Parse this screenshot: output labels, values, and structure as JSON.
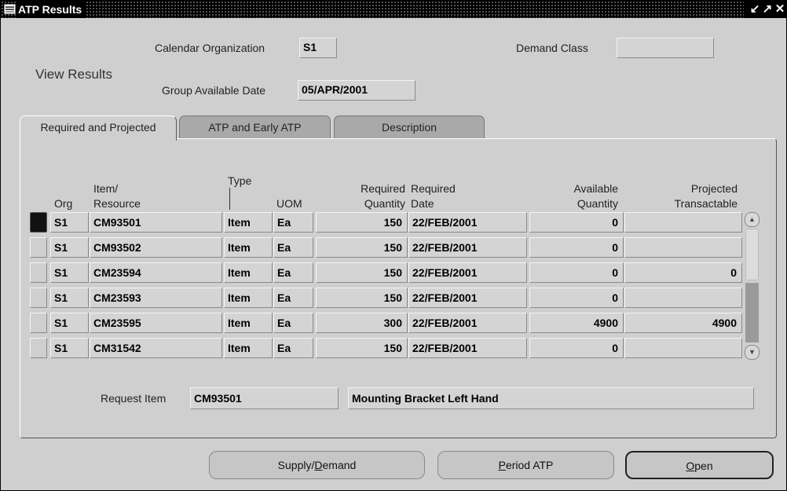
{
  "window": {
    "title": "ATP Results",
    "controls": [
      "↙",
      "↗",
      "✕"
    ]
  },
  "header": {
    "view_results_label": "View Results",
    "calendar_org_label": "Calendar Organization",
    "calendar_org_value": "S1",
    "demand_class_label": "Demand Class",
    "demand_class_value": "",
    "group_date_label": "Group Available Date",
    "group_date_value": "05/APR/2001"
  },
  "tabs": [
    {
      "label": "Required and Projected",
      "active": true
    },
    {
      "label": "ATP and Early ATP",
      "active": false
    },
    {
      "label": "Description",
      "active": false
    }
  ],
  "table": {
    "headers": {
      "org": "Org",
      "item1": "Item/",
      "item2": "Resource",
      "type": "Type",
      "uom": "UOM",
      "reqqty1": "Required",
      "reqqty2": "Quantity",
      "reqdate1": "Required",
      "reqdate2": "Date",
      "avail1": "Available",
      "avail2": "Quantity",
      "proj1": "Projected",
      "proj2": "Transactable"
    },
    "rows": [
      {
        "org": "S1",
        "item": "CM93501",
        "type": "Item",
        "uom": "Ea",
        "req_qty": "150",
        "req_date": "22/FEB/2001",
        "avail_qty": "0",
        "projected": ""
      },
      {
        "org": "S1",
        "item": "CM93502",
        "type": "Item",
        "uom": "Ea",
        "req_qty": "150",
        "req_date": "22/FEB/2001",
        "avail_qty": "0",
        "projected": ""
      },
      {
        "org": "S1",
        "item": "CM23594",
        "type": "Item",
        "uom": "Ea",
        "req_qty": "150",
        "req_date": "22/FEB/2001",
        "avail_qty": "0",
        "projected": "0"
      },
      {
        "org": "S1",
        "item": "CM23593",
        "type": "Item",
        "uom": "Ea",
        "req_qty": "150",
        "req_date": "22/FEB/2001",
        "avail_qty": "0",
        "projected": ""
      },
      {
        "org": "S1",
        "item": "CM23595",
        "type": "Item",
        "uom": "Ea",
        "req_qty": "300",
        "req_date": "22/FEB/2001",
        "avail_qty": "4900",
        "projected": "4900"
      },
      {
        "org": "S1",
        "item": "CM31542",
        "type": "Item",
        "uom": "Ea",
        "req_qty": "150",
        "req_date": "22/FEB/2001",
        "avail_qty": "0",
        "projected": ""
      }
    ]
  },
  "request": {
    "label": "Request Item",
    "item_value": "CM93501",
    "description_value": "Mounting Bracket Left Hand"
  },
  "buttons": {
    "supply_demand_pre": "Supply/",
    "supply_demand_key": "D",
    "supply_demand_post": "emand",
    "period_atp_key": "P",
    "period_atp_post": "eriod ATP",
    "open_key": "O",
    "open_post": "pen"
  }
}
